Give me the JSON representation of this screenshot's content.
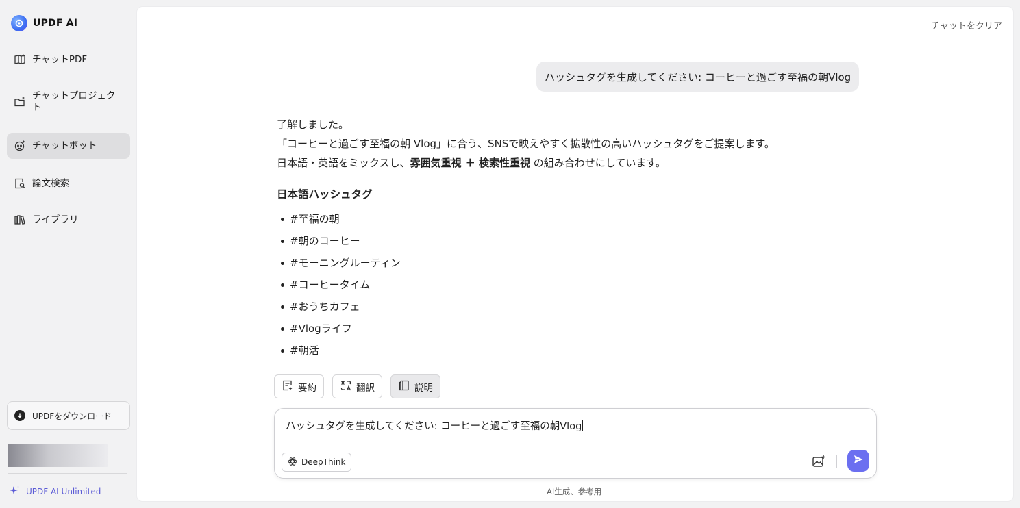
{
  "brand": {
    "name": "UPDF AI"
  },
  "sidebar": {
    "items": [
      {
        "label": "チャットPDF",
        "icon": "chat-pdf-icon"
      },
      {
        "label": "チャットプロジェクト",
        "icon": "folder-icon"
      },
      {
        "label": "チャットボット",
        "icon": "chatbot-icon",
        "active": true
      },
      {
        "label": "論文検索",
        "icon": "paper-search-icon"
      },
      {
        "label": "ライブラリ",
        "icon": "library-icon"
      }
    ],
    "download_label": "UPDFをダウンロード",
    "unlimited_label": "UPDF AI Unlimited"
  },
  "header": {
    "clear_chat": "チャットをクリア"
  },
  "conversation": {
    "user_message": "ハッシュタグを生成してください: コーヒーと過ごす至福の朝Vlog",
    "answer": {
      "line1": "了解しました。",
      "line2": "「コーヒーと過ごす至福の朝 Vlog」に合う、SNSで映えやすく拡散性の高いハッシュタグをご提案します。",
      "line3_prefix": "日本語・英語をミックスし、",
      "line3_bold": "雰囲気重視 ＋ 検索性重視",
      "line3_suffix": " の組み合わせにしています。",
      "section_title": "日本語ハッシュタグ",
      "tags": [
        "#至福の朝",
        "#朝のコーヒー",
        "#モーニングルーティン",
        "#コーヒータイム",
        "#おうちカフェ",
        "#Vlogライフ",
        "#朝活"
      ]
    }
  },
  "actions": [
    {
      "label": "要約",
      "icon": "summary-icon"
    },
    {
      "label": "翻訳",
      "icon": "translate-icon"
    },
    {
      "label": "説明",
      "icon": "explain-icon",
      "active": true
    }
  ],
  "composer": {
    "value": "ハッシュタグを生成してください: コーヒーと過ごす至福の朝Vlog",
    "deepthink_label": "DeepThink"
  },
  "footer_note": "AI生成、参考用",
  "colors": {
    "accent": "#6b6ff0",
    "active_nav": "#dedee0"
  }
}
